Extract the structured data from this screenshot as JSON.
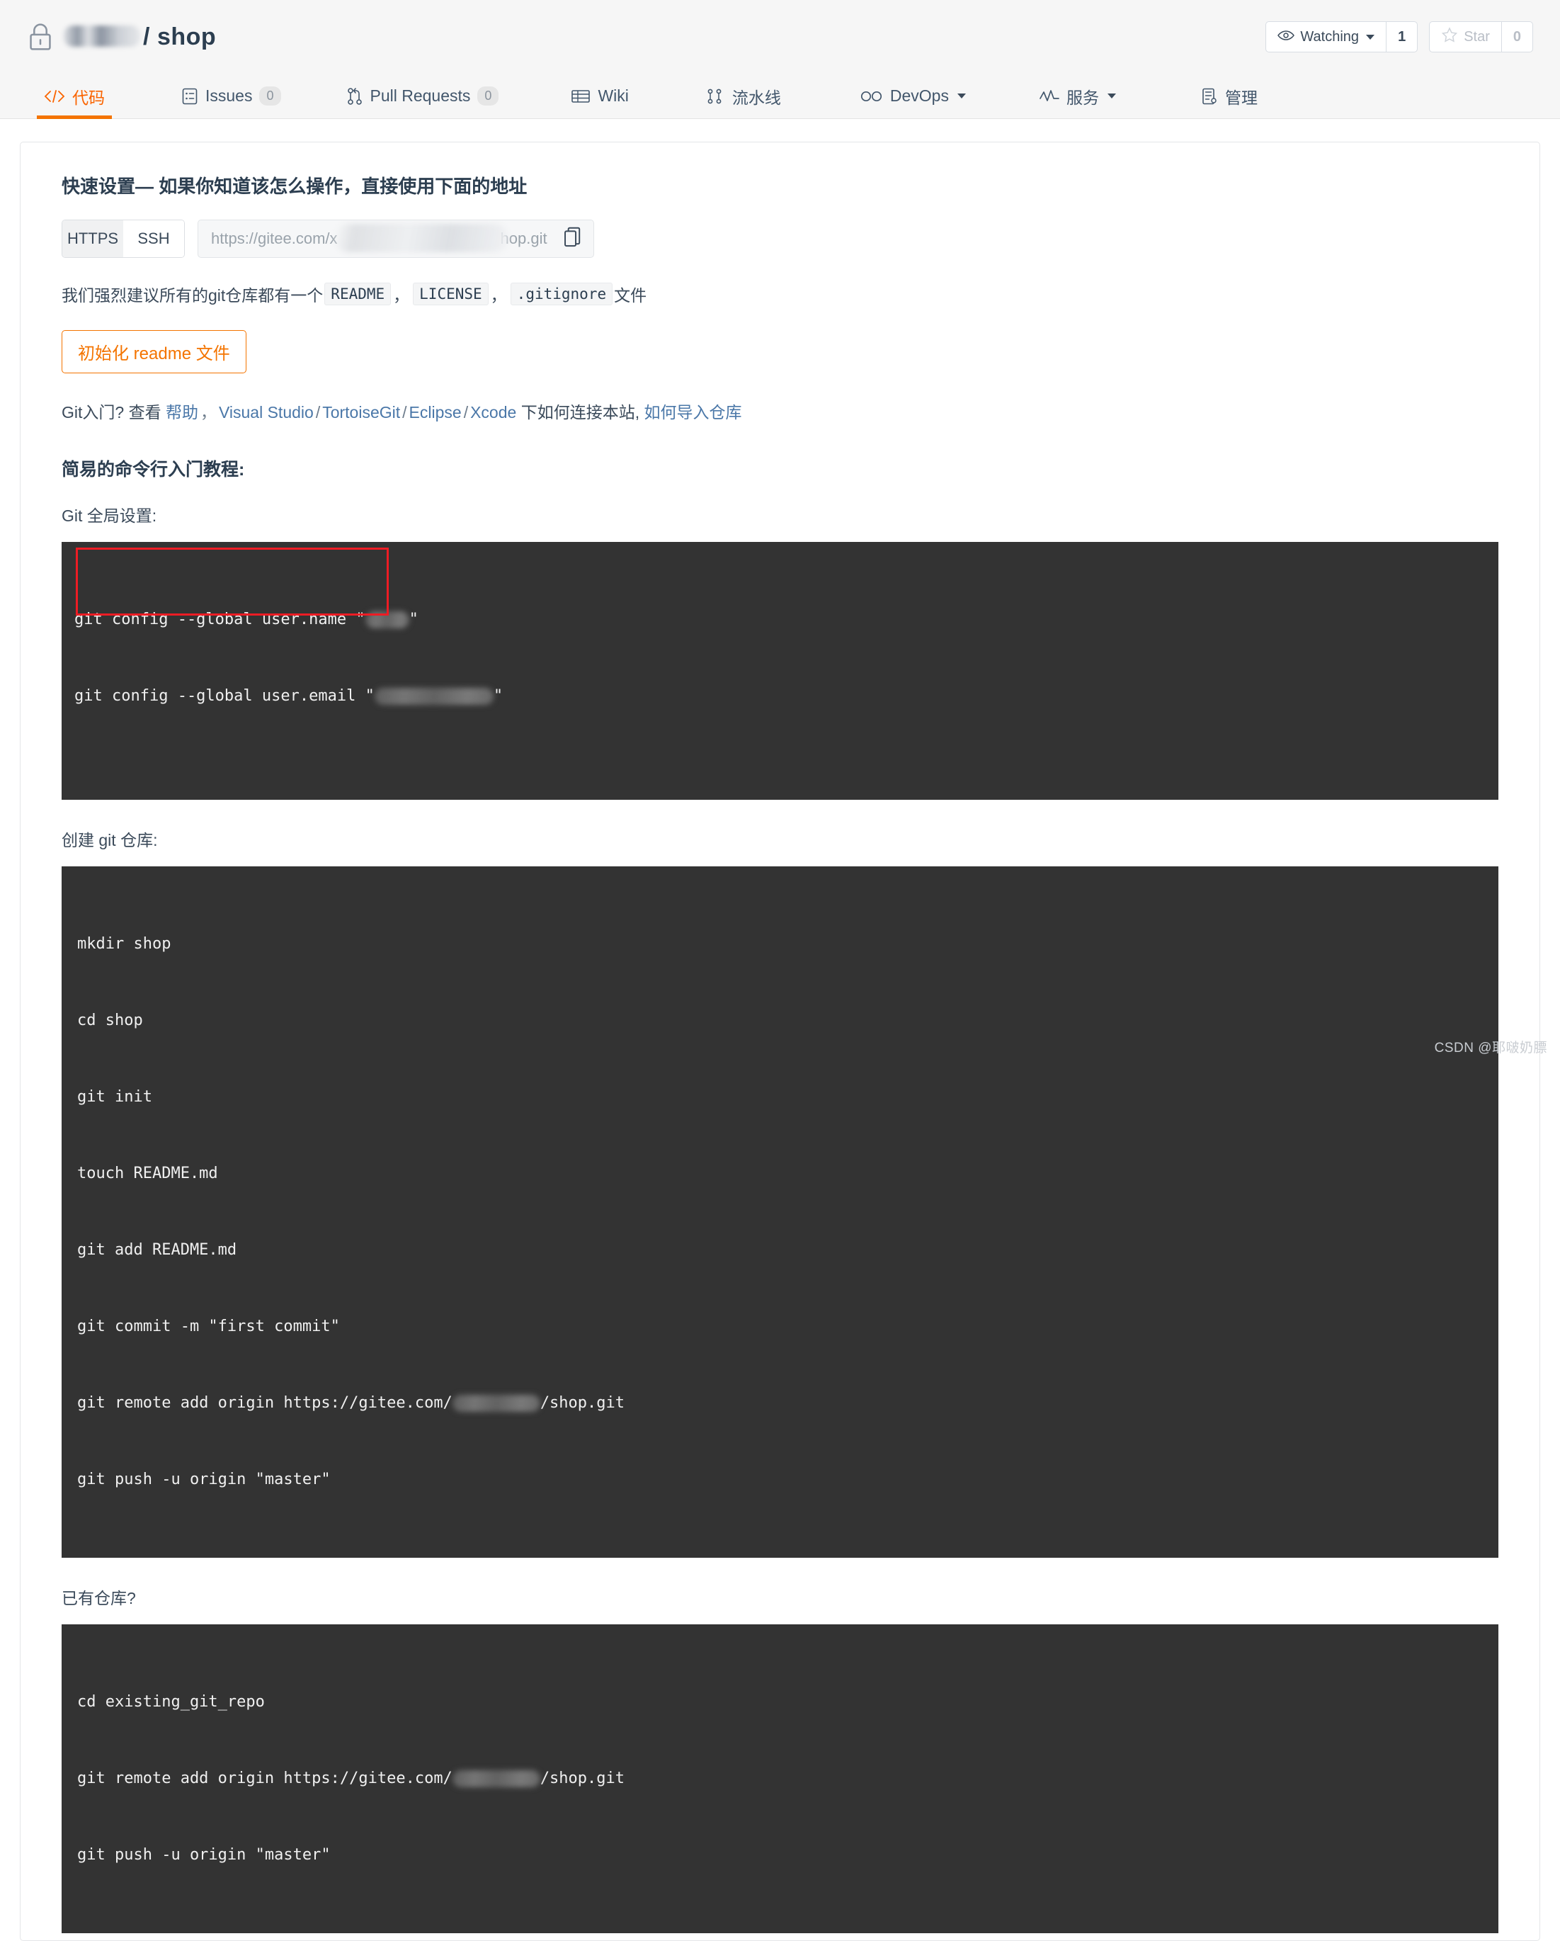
{
  "header": {
    "lock_icon": "lock-icon",
    "owner_masked": "",
    "separator": "/",
    "repo_name": "shop",
    "watch_label": "Watching",
    "watch_count": "1",
    "star_label": "Star",
    "star_count": "0",
    "eye_icon": "eye-icon",
    "star_icon": "star-icon"
  },
  "tabs": [
    {
      "label": "代码",
      "icon": "code-icon",
      "badge": "",
      "active": true,
      "caret": false
    },
    {
      "label": "Issues",
      "icon": "issue-icon",
      "badge": "0",
      "active": false,
      "caret": false
    },
    {
      "label": "Pull Requests",
      "icon": "pull-request-icon",
      "badge": "0",
      "active": false,
      "caret": false
    },
    {
      "label": "Wiki",
      "icon": "wiki-icon",
      "badge": "",
      "active": false,
      "caret": false
    },
    {
      "label": "流水线",
      "icon": "pipeline-icon",
      "badge": "",
      "active": false,
      "caret": false
    },
    {
      "label": "DevOps",
      "icon": "infinity-icon",
      "badge": "",
      "active": false,
      "caret": true
    },
    {
      "label": "服务",
      "icon": "activity-icon",
      "badge": "",
      "active": false,
      "caret": true
    },
    {
      "label": "管理",
      "icon": "settings-icon",
      "badge": "",
      "active": false,
      "caret": false
    }
  ],
  "quick_setup": {
    "title": "快速设置— 如果你知道该怎么操作，直接使用下面的地址",
    "protocol_https": "HTTPS",
    "protocol_ssh": "SSH",
    "protocol_selected": "HTTPS",
    "clone_url_prefix": "https://gitee.com/x",
    "clone_url_suffix": "hop.git",
    "copy_icon": "copy-icon",
    "suggest_prefix": "我们强烈建议所有的git仓库都有一个",
    "chip_readme": "README",
    "chip_license": "LICENSE",
    "chip_gitignore": ".gitignore",
    "suggest_suffix": "文件",
    "comma": "，",
    "init_readme_button": "初始化 readme 文件"
  },
  "help": {
    "prefix": "Git入门?",
    "view": "查看",
    "link_help": "帮助",
    "comma": "，",
    "link_vs": "Visual Studio",
    "link_tortoise": "TortoiseGit",
    "link_eclipse": "Eclipse",
    "link_xcode": "Xcode",
    "middle": "下如何连接本站,",
    "link_import": "如何导入仓库"
  },
  "tutorial": {
    "title": "简易的命令行入门教程:",
    "global_label": "Git 全局设置:",
    "global_code": [
      "git config --global user.name \"",
      "git config --global user.email \""
    ],
    "create_label": "创建 git 仓库:",
    "create_code": [
      "mkdir shop",
      "cd shop",
      "git init",
      "touch README.md",
      "git add README.md",
      "git commit -m \"first commit\"",
      "git remote add origin https://gitee.com/",
      "git push -u origin \"master\""
    ],
    "create_code_suffix": "/shop.git",
    "existing_label": "已有仓库?",
    "existing_code": [
      "cd existing_git_repo",
      "git remote add origin https://gitee.com/",
      "git push -u origin \"master\""
    ],
    "existing_code_suffix": "/shop.git"
  },
  "annotation": {
    "color": "#ee1c24",
    "shape": "rectangle"
  },
  "watermark": "CSDN @耶啵奶膘",
  "colors": {
    "accent_orange": "#f47400",
    "header_bg": "#f6f6f6",
    "code_bg": "#333333",
    "link_blue": "#4a77a8",
    "text_dark": "#2c3e50"
  }
}
